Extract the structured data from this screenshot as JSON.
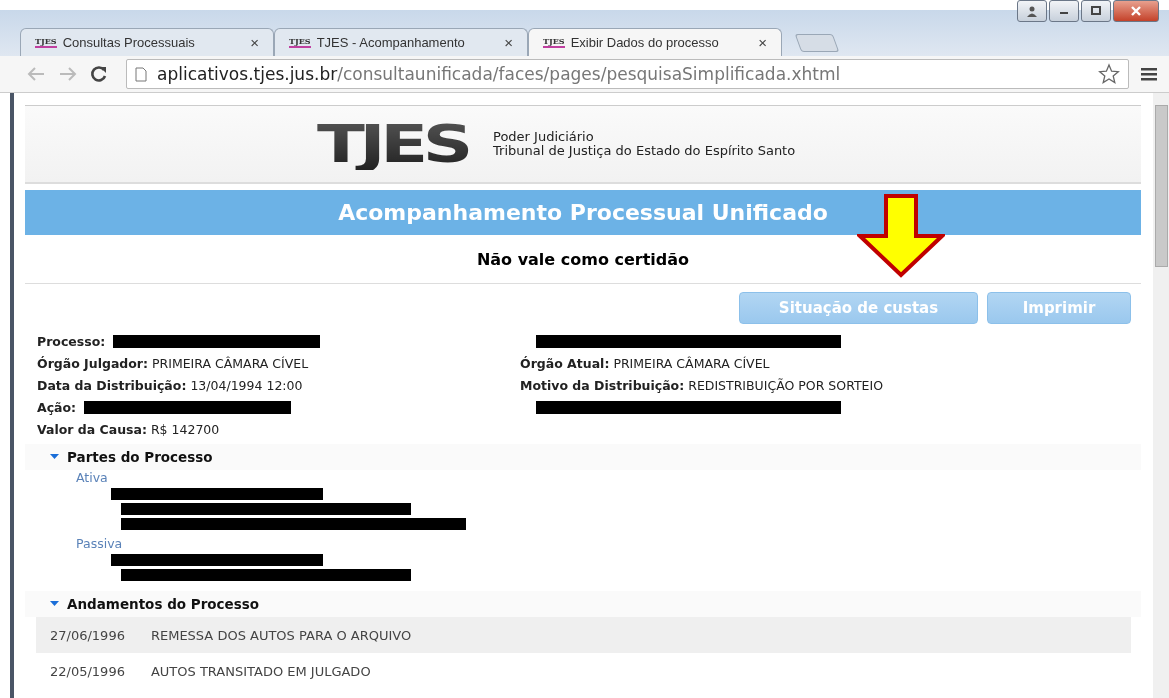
{
  "browser": {
    "tabs": [
      {
        "favicon": "TJES",
        "title": "Consultas Processuais",
        "close": "×",
        "selected": false
      },
      {
        "favicon": "TJES",
        "title": "TJES - Acompanhamento",
        "close": "×",
        "selected": false
      },
      {
        "favicon": "TJES",
        "title": "Exibir Dados do processo",
        "close": "×",
        "selected": true
      }
    ],
    "url_host": "aplicativos.tjes.jus.br",
    "url_path": "/consultaunificada/faces/pages/pesquisaSimplificada.xhtml"
  },
  "header": {
    "logo": "TJES",
    "org_line_1": "Poder Judiciário",
    "org_line_2": "Tribunal de Justiça do Estado do Espírito Santo"
  },
  "banner": "Acompanhamento Processual Unificado",
  "notice": "Não vale como certidão",
  "buttons": [
    {
      "label": "Situação de custas"
    },
    {
      "label": "Imprimir"
    }
  ],
  "annotation": {
    "kind": "arrow"
  },
  "details_left": [
    {
      "label": "Processo:",
      "redacted": true
    },
    {
      "label": "Órgão Julgador:",
      "value": "PRIMEIRA CÂMARA CÍVEL"
    },
    {
      "label": "Data da Distribuição:",
      "value": "13/04/1994 12:00"
    },
    {
      "label": "Ação:",
      "redacted": true
    },
    {
      "label": "Valor da Causa:",
      "value": "R$ 142700"
    }
  ],
  "details_right": [
    {
      "redacted": true
    },
    {
      "label": "Órgão Atual:",
      "value": "PRIMEIRA CÂMARA CÍVEL"
    },
    {
      "label": "Motivo da Distribuição:",
      "value": "REDISTRIBUIÇÃO POR SORTEIO"
    },
    {
      "redacted": true
    }
  ],
  "parties": {
    "title": "Partes do Processo",
    "expanded": true,
    "groups": [
      {
        "role": "Ativa",
        "lines": [
          {
            "redacted": true
          },
          {
            "redacted": true
          },
          {
            "redacted": true
          }
        ]
      },
      {
        "role": "Passiva",
        "lines": [
          {
            "redacted": true
          },
          {
            "redacted": true
          }
        ]
      }
    ]
  },
  "movements": {
    "title": "Andamentos do Processo",
    "expanded": true,
    "rows": [
      {
        "date": "27/06/1996",
        "text": "REMESSA DOS AUTOS PARA O ARQUIVO"
      },
      {
        "date": "22/05/1996",
        "text": "AUTOS TRANSITADO EM JULGADO"
      }
    ]
  }
}
